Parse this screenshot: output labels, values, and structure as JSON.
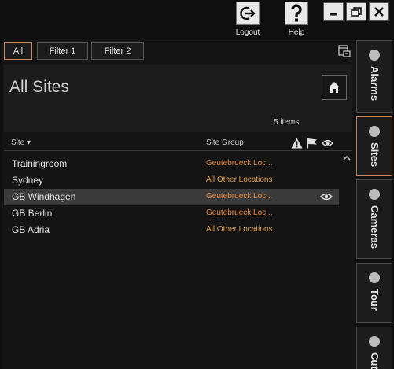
{
  "toolbar": {
    "logout_label": "Logout",
    "help_label": "Help",
    "logout_icon": "logout-icon",
    "help_icon": "question-mark-icon"
  },
  "window_controls": [
    "minimize-icon",
    "maximize-icon",
    "close-icon"
  ],
  "filter_tabs": [
    {
      "label": "All",
      "active": true
    },
    {
      "label": "Filter 1",
      "active": false
    },
    {
      "label": "Filter 2",
      "active": false
    }
  ],
  "header": {
    "title": "All Sites",
    "items_count": "5 items"
  },
  "columns": {
    "site": "Site ▾",
    "site_group": "Site Group"
  },
  "rows": [
    {
      "site": "Trainingroom",
      "group": "Geutebrueck Loc...",
      "group_color": "#e8893a",
      "selected": false
    },
    {
      "site": "Sydney",
      "group": "All Other Locations",
      "group_color": "#e0a24a",
      "selected": false
    },
    {
      "site": "GB Windhagen",
      "group": "Geutebrueck Loc...",
      "group_color": "#e8893a",
      "selected": true
    },
    {
      "site": "GB Berlin",
      "group": "Geutebrueck Loc...",
      "group_color": "#e8893a",
      "selected": false
    },
    {
      "site": "GB Adria",
      "group": "All Other Locations",
      "group_color": "#e0a24a",
      "selected": false
    }
  ],
  "side_tabs": [
    {
      "label": "Alarms",
      "active": false
    },
    {
      "label": "Sites",
      "active": true
    },
    {
      "label": "Cameras",
      "active": false
    },
    {
      "label": "Tour",
      "active": false
    },
    {
      "label": "Cut",
      "active": false
    }
  ],
  "colors": {
    "accent": "#c98555",
    "background": "#141414"
  }
}
